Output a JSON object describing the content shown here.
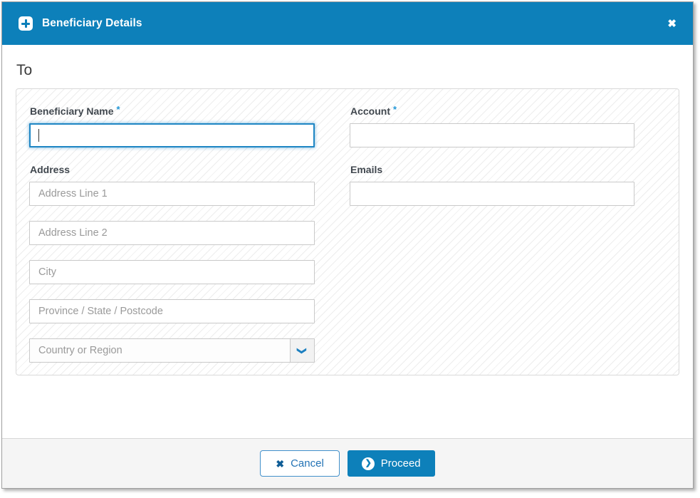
{
  "modal": {
    "title": "Beneficiary Details",
    "section_heading": "To"
  },
  "icons": {
    "close": "✖",
    "cancel_x": "✖",
    "proceed_chevron": "❯",
    "dropdown_chevron": "❯"
  },
  "form": {
    "beneficiary_name": {
      "label": "Beneficiary Name",
      "required_marker": "*",
      "value": ""
    },
    "account": {
      "label": "Account",
      "required_marker": "*",
      "value": ""
    },
    "emails": {
      "label": "Emails",
      "value": ""
    },
    "address": {
      "label": "Address",
      "line1_placeholder": "Address Line 1",
      "line1_value": "",
      "line2_placeholder": "Address Line 2",
      "line2_value": "",
      "city_placeholder": "City",
      "city_value": "",
      "province_placeholder": "Province / State / Postcode",
      "province_value": "",
      "country_placeholder": "Country or Region"
    }
  },
  "footer": {
    "cancel_label": "Cancel",
    "proceed_label": "Proceed"
  },
  "colors": {
    "header_blue": "#0d80ba",
    "asterisk_blue": "#2196d6",
    "focus_border_blue": "#1e86c4",
    "cancel_text_blue": "#2373b5",
    "chevron_blue": "#1b7fc0",
    "footer_gray": "#f5f5f5"
  }
}
